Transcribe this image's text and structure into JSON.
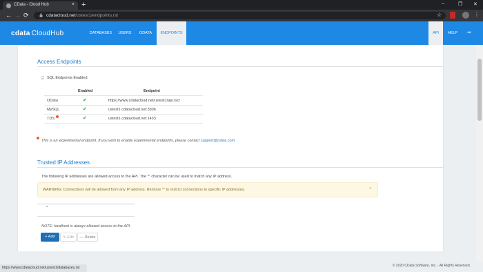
{
  "browser": {
    "tab_title": "CData - Cloud Hub",
    "tab_close": "×",
    "new_tab": "+",
    "window_controls": [
      "–",
      "❐",
      "✕"
    ],
    "nav": {
      "back": "←",
      "forward": "→",
      "reload": "⟳"
    },
    "url_host": "cdatacloud.net",
    "url_path": "/ustest1/endpoints.rst",
    "star": "☆",
    "menu": "⋮",
    "status_url": "https://www.cdatacloud.net/ustest1/databases.rst"
  },
  "app": {
    "logo_main": "cdata",
    "logo_sub": "CloudHub",
    "nav_items": [
      "DATABASES",
      "USERS",
      "ODATA",
      "ENDPOINTS"
    ],
    "active_nav": "ENDPOINTS",
    "right_nav": [
      "API",
      "HELP"
    ],
    "logout_icon": "⇥",
    "brand_color": "#1e88e5"
  },
  "access_endpoints": {
    "title": "Access Endpoints",
    "sql_enabled_label": "SQL Endpoints Enabled",
    "sql_enabled": true,
    "columns": [
      "Enabled",
      "Endpoint"
    ],
    "rows": [
      {
        "name": "OData",
        "enabled": true,
        "endpoint": "https://www.cdatacloud.net/ustest1/api.rsc/"
      },
      {
        "name": "MySQL",
        "enabled": true,
        "endpoint": "ustest1.cdatacloud.net:3306"
      },
      {
        "name": "TDS",
        "enabled": true,
        "endpoint": "ustest1.cdatacloud.net:1433",
        "experimental": true
      }
    ],
    "check_glyph": "✔",
    "experimental_note_prefix": "This is an experimental endpoint. If you wish to enable experimental endpoints, please contact ",
    "experimental_note_link": "support@cdata.com",
    "experimental_note_suffix": "."
  },
  "trusted_ip": {
    "title": "Trusted IP Addresses",
    "description": "The following IP addresses are allowed access to the API. The '*' character can be used to match any IP address.",
    "warning": "WARNING: Connections will be allowed from any IP address. Remove '*' to restrict connections to specific IP addresses.",
    "warning_close": "×",
    "ip_list": [
      "*"
    ],
    "note": "NOTE: localhost is always allowed access to the API.",
    "buttons": {
      "add": "+ Add",
      "edit": "✎ Edit",
      "delete": "— Delete"
    }
  },
  "footer": {
    "copyright": "© 2020 CData Software, Inc. - All Rights Reserved."
  }
}
